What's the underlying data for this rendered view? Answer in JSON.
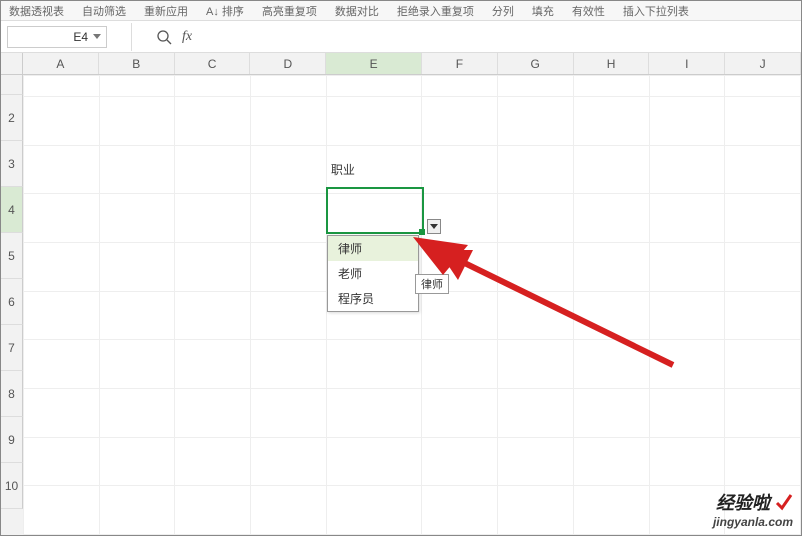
{
  "ribbon": {
    "items": [
      "数据透视表",
      "自动筛选",
      "重新应用",
      "A↓ 排序",
      "高亮重复项",
      "数据对比",
      "拒绝录入重复项",
      "分列",
      "填充",
      "有效性",
      "插入下拉列表",
      ""
    ]
  },
  "nameBox": {
    "value": "E4"
  },
  "formulaBar": {
    "fx": "fx",
    "value": ""
  },
  "columns": [
    "A",
    "B",
    "C",
    "D",
    "E",
    "F",
    "G",
    "H",
    "I",
    "J"
  ],
  "rows": [
    "2",
    "3",
    "4",
    "5",
    "6",
    "7",
    "8",
    "9",
    "10"
  ],
  "cells": {
    "E3": "职业"
  },
  "dropdown": {
    "options": [
      "律师",
      "老师",
      "程序员"
    ],
    "tooltip": "律师"
  },
  "watermark": {
    "cn": "经验啦",
    "en": "jingyanla.com"
  }
}
